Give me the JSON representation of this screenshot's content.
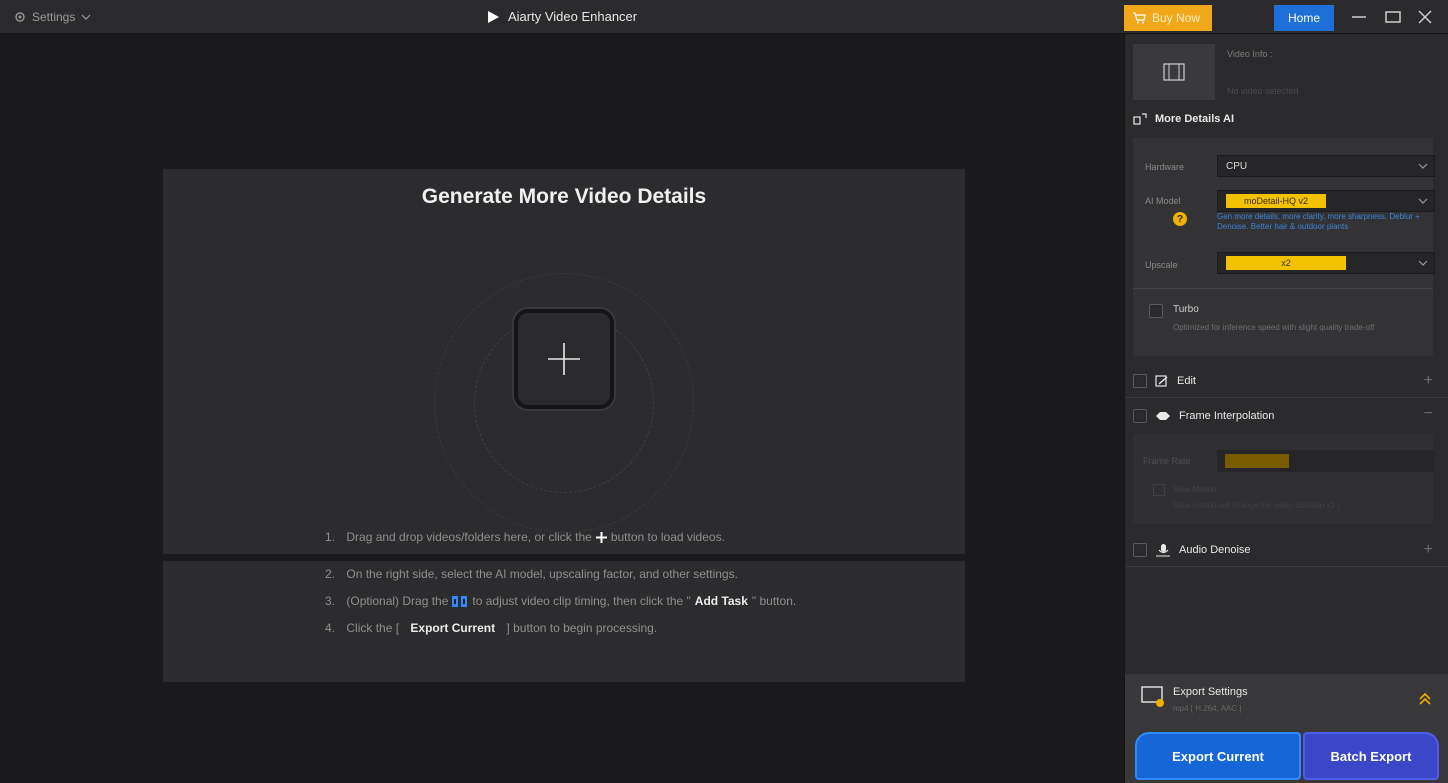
{
  "titlebar": {
    "settings_label": "Settings",
    "app_title": "Aiarty Video Enhancer",
    "buy_label": "Buy Now",
    "home_label": "Home"
  },
  "main": {
    "title": "Generate More Video Details",
    "steps": [
      {
        "num": "1.",
        "before": "Drag and drop videos/folders here, or click the",
        "after": "button to load videos."
      },
      {
        "num": "2.",
        "text": "On the right side, select the AI model, upscaling factor, and other settings."
      },
      {
        "num": "3.",
        "before": "(Optional) Drag the",
        "middle": "to adjust video clip timing, then click the \"",
        "bold": "Add Task",
        "after": "\" button."
      },
      {
        "num": "4.",
        "before": "Click the [",
        "bold": "Export Current",
        "after": "] button to begin processing."
      }
    ]
  },
  "panel": {
    "video_info": {
      "label": "Video Info :",
      "sub": "No video selected"
    },
    "more_details": {
      "title": "More Details AI"
    },
    "hardware": {
      "label": "Hardware",
      "value": "CPU"
    },
    "ai_model": {
      "label": "AI Model",
      "value": "moDetail-HQ  v2",
      "desc": "Gen more details, more clarity, more sharpness. Deblur + Denoise. Better hair & outdoor plants"
    },
    "upscale": {
      "label": "Upscale",
      "value": "x2"
    },
    "turbo": {
      "label": "Turbo",
      "desc": "Optimized for inference speed with slight quality trade-off"
    },
    "edit": {
      "label": "Edit"
    },
    "frame_interp": {
      "label": "Frame Interpolation",
      "rate_label": "Frame Rate",
      "slow_label": "Slow Motion",
      "slow_desc": "Slow motion will change the video duration x2 )"
    },
    "audio": {
      "label": "Audio Denoise"
    },
    "export": {
      "title": "Export Settings",
      "sub": "mp4 [ H.264, AAC ]",
      "current_label": "Export Current",
      "batch_label": "Batch Export"
    }
  },
  "colors": {
    "accent_blue": "#1766d8",
    "buy_orange": "#f0a81a",
    "model_yellow": "#f3c200"
  }
}
